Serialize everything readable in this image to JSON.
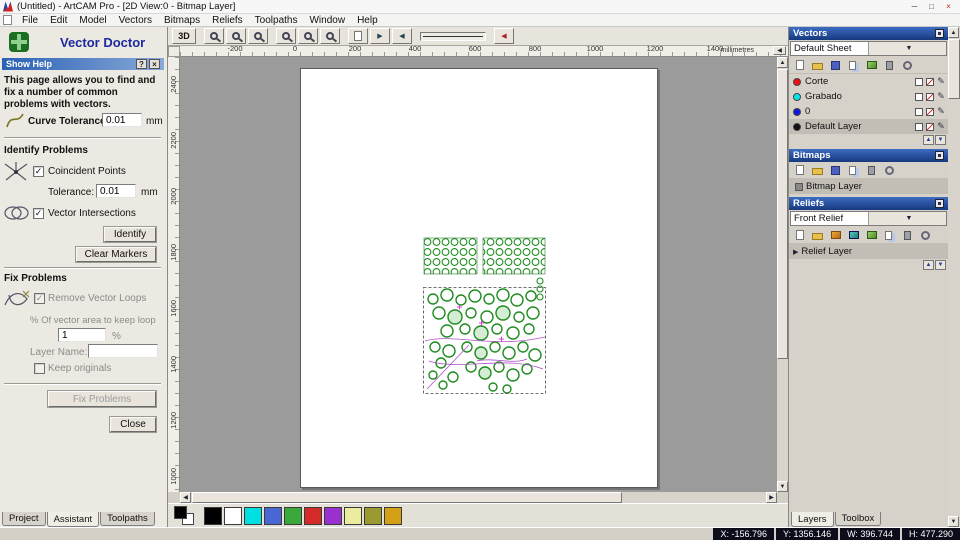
{
  "window": {
    "title": "(Untitled) - ArtCAM Pro - [2D View:0 - Bitmap Layer]",
    "minimize": "─",
    "maximize": "□",
    "close": "×"
  },
  "menu": {
    "items": [
      "File",
      "Edit",
      "Model",
      "Vectors",
      "Bitmaps",
      "Reliefs",
      "Toolpaths",
      "Window",
      "Help"
    ]
  },
  "assistant": {
    "title": "Vector Doctor",
    "show_help": "Show Help",
    "help_btn": "?",
    "help_close_btn": "×",
    "description": "This page allows you to find and fix a number of common problems with vectors.",
    "curve_tolerance": {
      "label": "Curve Tolerance",
      "value": "0.01",
      "unit": "mm"
    },
    "identify_heading": "Identify Problems",
    "coincident_points_label": "Coincident Points",
    "tolerance": {
      "label": "Tolerance:",
      "value": "0.01",
      "unit": "mm"
    },
    "vector_intersections_label": "Vector Intersections",
    "identify_button": "Identify",
    "clear_markers_button": "Clear Markers",
    "fix_heading": "Fix Problems",
    "remove_loops_label": "Remove Vector Loops",
    "keep_loop_label": "% Of vector area to keep loop",
    "keep_loop": {
      "value": "1",
      "unit": "%"
    },
    "layer_name_label": "Layer Name:",
    "layer_name_value": "",
    "keep_originals_label": "Keep originals",
    "fix_button": "Fix Problems",
    "close_button": "Close",
    "tabs": [
      "Project",
      "Assistant",
      "Toolpaths"
    ]
  },
  "toolbar": {
    "view_toggle": "3D"
  },
  "canvas": {
    "ruler_top": [
      "-200",
      "0",
      "200",
      "400",
      "600",
      "800",
      "1000",
      "1200",
      "1400"
    ],
    "ruler_left": [
      "2400",
      "2200",
      "2000",
      "1800",
      "1600",
      "1400",
      "1200",
      "1000"
    ],
    "units": "millimetres"
  },
  "palette": {
    "colors": [
      "#000000",
      "#ffffff",
      "#00e0e0",
      "#4a66d4",
      "#3aa83a",
      "#d42a2a",
      "#9a30d0",
      "#ecec9e",
      "#9a9a30",
      "#d4a018"
    ]
  },
  "vectors_panel": {
    "title": "Vectors",
    "sheet_dropdown": "Default Sheet",
    "layers": [
      {
        "name": "Corte",
        "color": "#ee1111"
      },
      {
        "name": "Grabado",
        "color": "#00e8e8"
      },
      {
        "name": "0",
        "color": "#1414e0"
      },
      {
        "name": "Default Layer",
        "color": "#101010"
      }
    ]
  },
  "bitmaps_panel": {
    "title": "Bitmaps",
    "layer": "Bitmap Layer"
  },
  "reliefs_panel": {
    "title": "Reliefs",
    "dropdown": "Front Relief",
    "layer": "Relief Layer"
  },
  "right_tabs": [
    "Layers",
    "Toolbox"
  ],
  "status": {
    "x": "X: -156.796",
    "y": "Y: 1356.146",
    "w": "W: 396.744",
    "h": "H: 477.290"
  }
}
